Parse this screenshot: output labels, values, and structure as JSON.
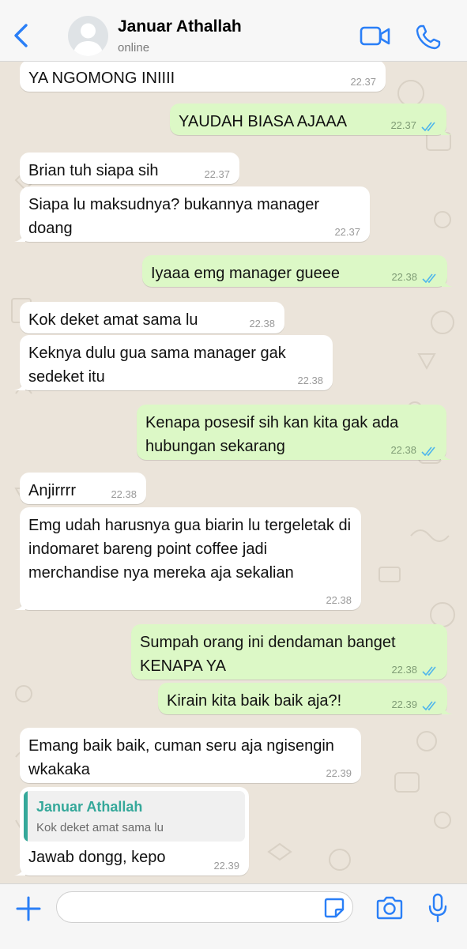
{
  "header": {
    "contact_name": "Januar Athallah",
    "status": "online"
  },
  "colors": {
    "accent": "#2a7ff7",
    "incoming_bubble": "#ffffff",
    "outgoing_bubble": "#dcf8c6",
    "read_ticks": "#4fb6ec",
    "quote_name": "#35a89a"
  },
  "icons": {
    "back": "chevron-left-icon",
    "avatar": "person-icon",
    "video_call": "video-camera-icon",
    "voice_call": "phone-icon",
    "attach": "plus-icon",
    "sticker": "sticker-icon",
    "camera": "camera-icon",
    "mic": "microphone-icon"
  },
  "messages": [
    {
      "dir": "in",
      "text": "YA NGOMONG INIIII",
      "time": "22.37"
    },
    {
      "dir": "out",
      "text": "YAUDAH BIASA AJAAA",
      "time": "22.37",
      "read": true
    },
    {
      "dir": "in",
      "text": "Brian tuh siapa sih",
      "time": "22.37"
    },
    {
      "dir": "in",
      "text": "Siapa lu maksudnya? bukannya manager doang",
      "time": "22.37"
    },
    {
      "dir": "out",
      "text": "Iyaaa emg manager gueee",
      "time": "22.38",
      "read": true
    },
    {
      "dir": "in",
      "text": "Kok deket amat sama lu",
      "time": "22.38"
    },
    {
      "dir": "in",
      "text": "Keknya dulu gua sama manager gak sedeket itu",
      "time": "22.38"
    },
    {
      "dir": "out",
      "text": "Kenapa posesif sih kan kita gak ada hubungan sekarang",
      "time": "22.38",
      "read": true
    },
    {
      "dir": "in",
      "text": "Anjirrrr",
      "time": "22.38"
    },
    {
      "dir": "in",
      "text": "Emg udah harusnya gua biarin lu tergeletak di indomaret bareng point coffee jadi merchandise nya mereka aja sekalian",
      "time": "22.38"
    },
    {
      "dir": "out",
      "text": "Sumpah orang ini dendaman banget KENAPA YA",
      "time": "22.38",
      "read": true
    },
    {
      "dir": "out",
      "text": "Kirain kita baik baik aja?!",
      "time": "22.39",
      "read": true
    },
    {
      "dir": "in",
      "text": "Emang baik baik, cuman seru aja ngisengin wkakaka",
      "time": "22.39"
    },
    {
      "dir": "in",
      "text": "Jawab dongg, kepo",
      "time": "22.39",
      "quote": {
        "name": "Januar Athallah",
        "text": "Kok deket amat sama lu"
      }
    }
  ],
  "composer": {
    "value": "",
    "placeholder": ""
  }
}
